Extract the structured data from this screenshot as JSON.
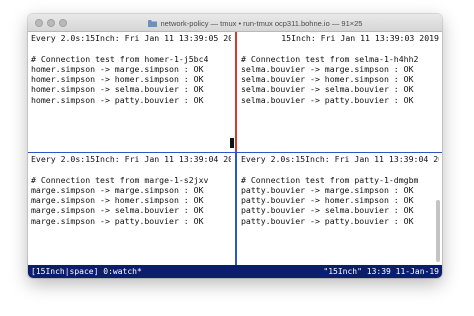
{
  "window": {
    "title": "network-policy — tmux • run-tmux ocp311.bohne.io — 91×25"
  },
  "panes": [
    {
      "header_left": "Every 2.0s:",
      "header_right": "15Inch: Fri Jan 11 13:39:05 2019",
      "lines": [
        "",
        "# Connection test from homer-1-j5bc4",
        "homer.simpson -> marge.simpson : OK",
        "homer.simpson -> homer.simpson : OK",
        "homer.simpson -> selma.bouvier : OK",
        "homer.simpson -> patty.bouvier : OK"
      ]
    },
    {
      "header_left": "",
      "header_right": "15Inch: Fri Jan 11 13:39:03 2019",
      "lines": [
        "",
        "# Connection test from selma-1-h4hh2",
        "selma.bouvier -> marge.simpson : OK",
        "selma.bouvier -> homer.simpson : OK",
        "selma.bouvier -> selma.bouvier : OK",
        "selma.bouvier -> patty.bouvier : OK"
      ]
    },
    {
      "header_left": "Every 2.0s:",
      "header_right": "15Inch: Fri Jan 11 13:39:04 2019",
      "lines": [
        "",
        "# Connection test from marge-1-s2jxv",
        "marge.simpson -> marge.simpson : OK",
        "marge.simpson -> homer.simpson : OK",
        "marge.simpson -> selma.bouvier : OK",
        "marge.simpson -> patty.bouvier : OK"
      ]
    },
    {
      "header_left": "Every 2.0s:",
      "header_right": "15Inch: Fri Jan 11 13:39:04 2019",
      "lines": [
        "",
        "# Connection test from patty-1-dmgbm",
        "patty.bouvier -> marge.simpson : OK",
        "patty.bouvier -> homer.simpson : OK",
        "patty.bouvier -> selma.bouvier : OK",
        "patty.bouvier -> patty.bouvier : OK"
      ]
    }
  ],
  "status_bar": {
    "left": "[15Inch|space] 0:watch*",
    "right": "\"15Inch\" 13:39 11-Jan-19"
  },
  "colors": {
    "active_pane_border": "#d23b2f",
    "pane_border": "#2d55c5",
    "status_bg": "#0c1e6b"
  },
  "icons": {
    "title_icon": "folder-icon"
  }
}
